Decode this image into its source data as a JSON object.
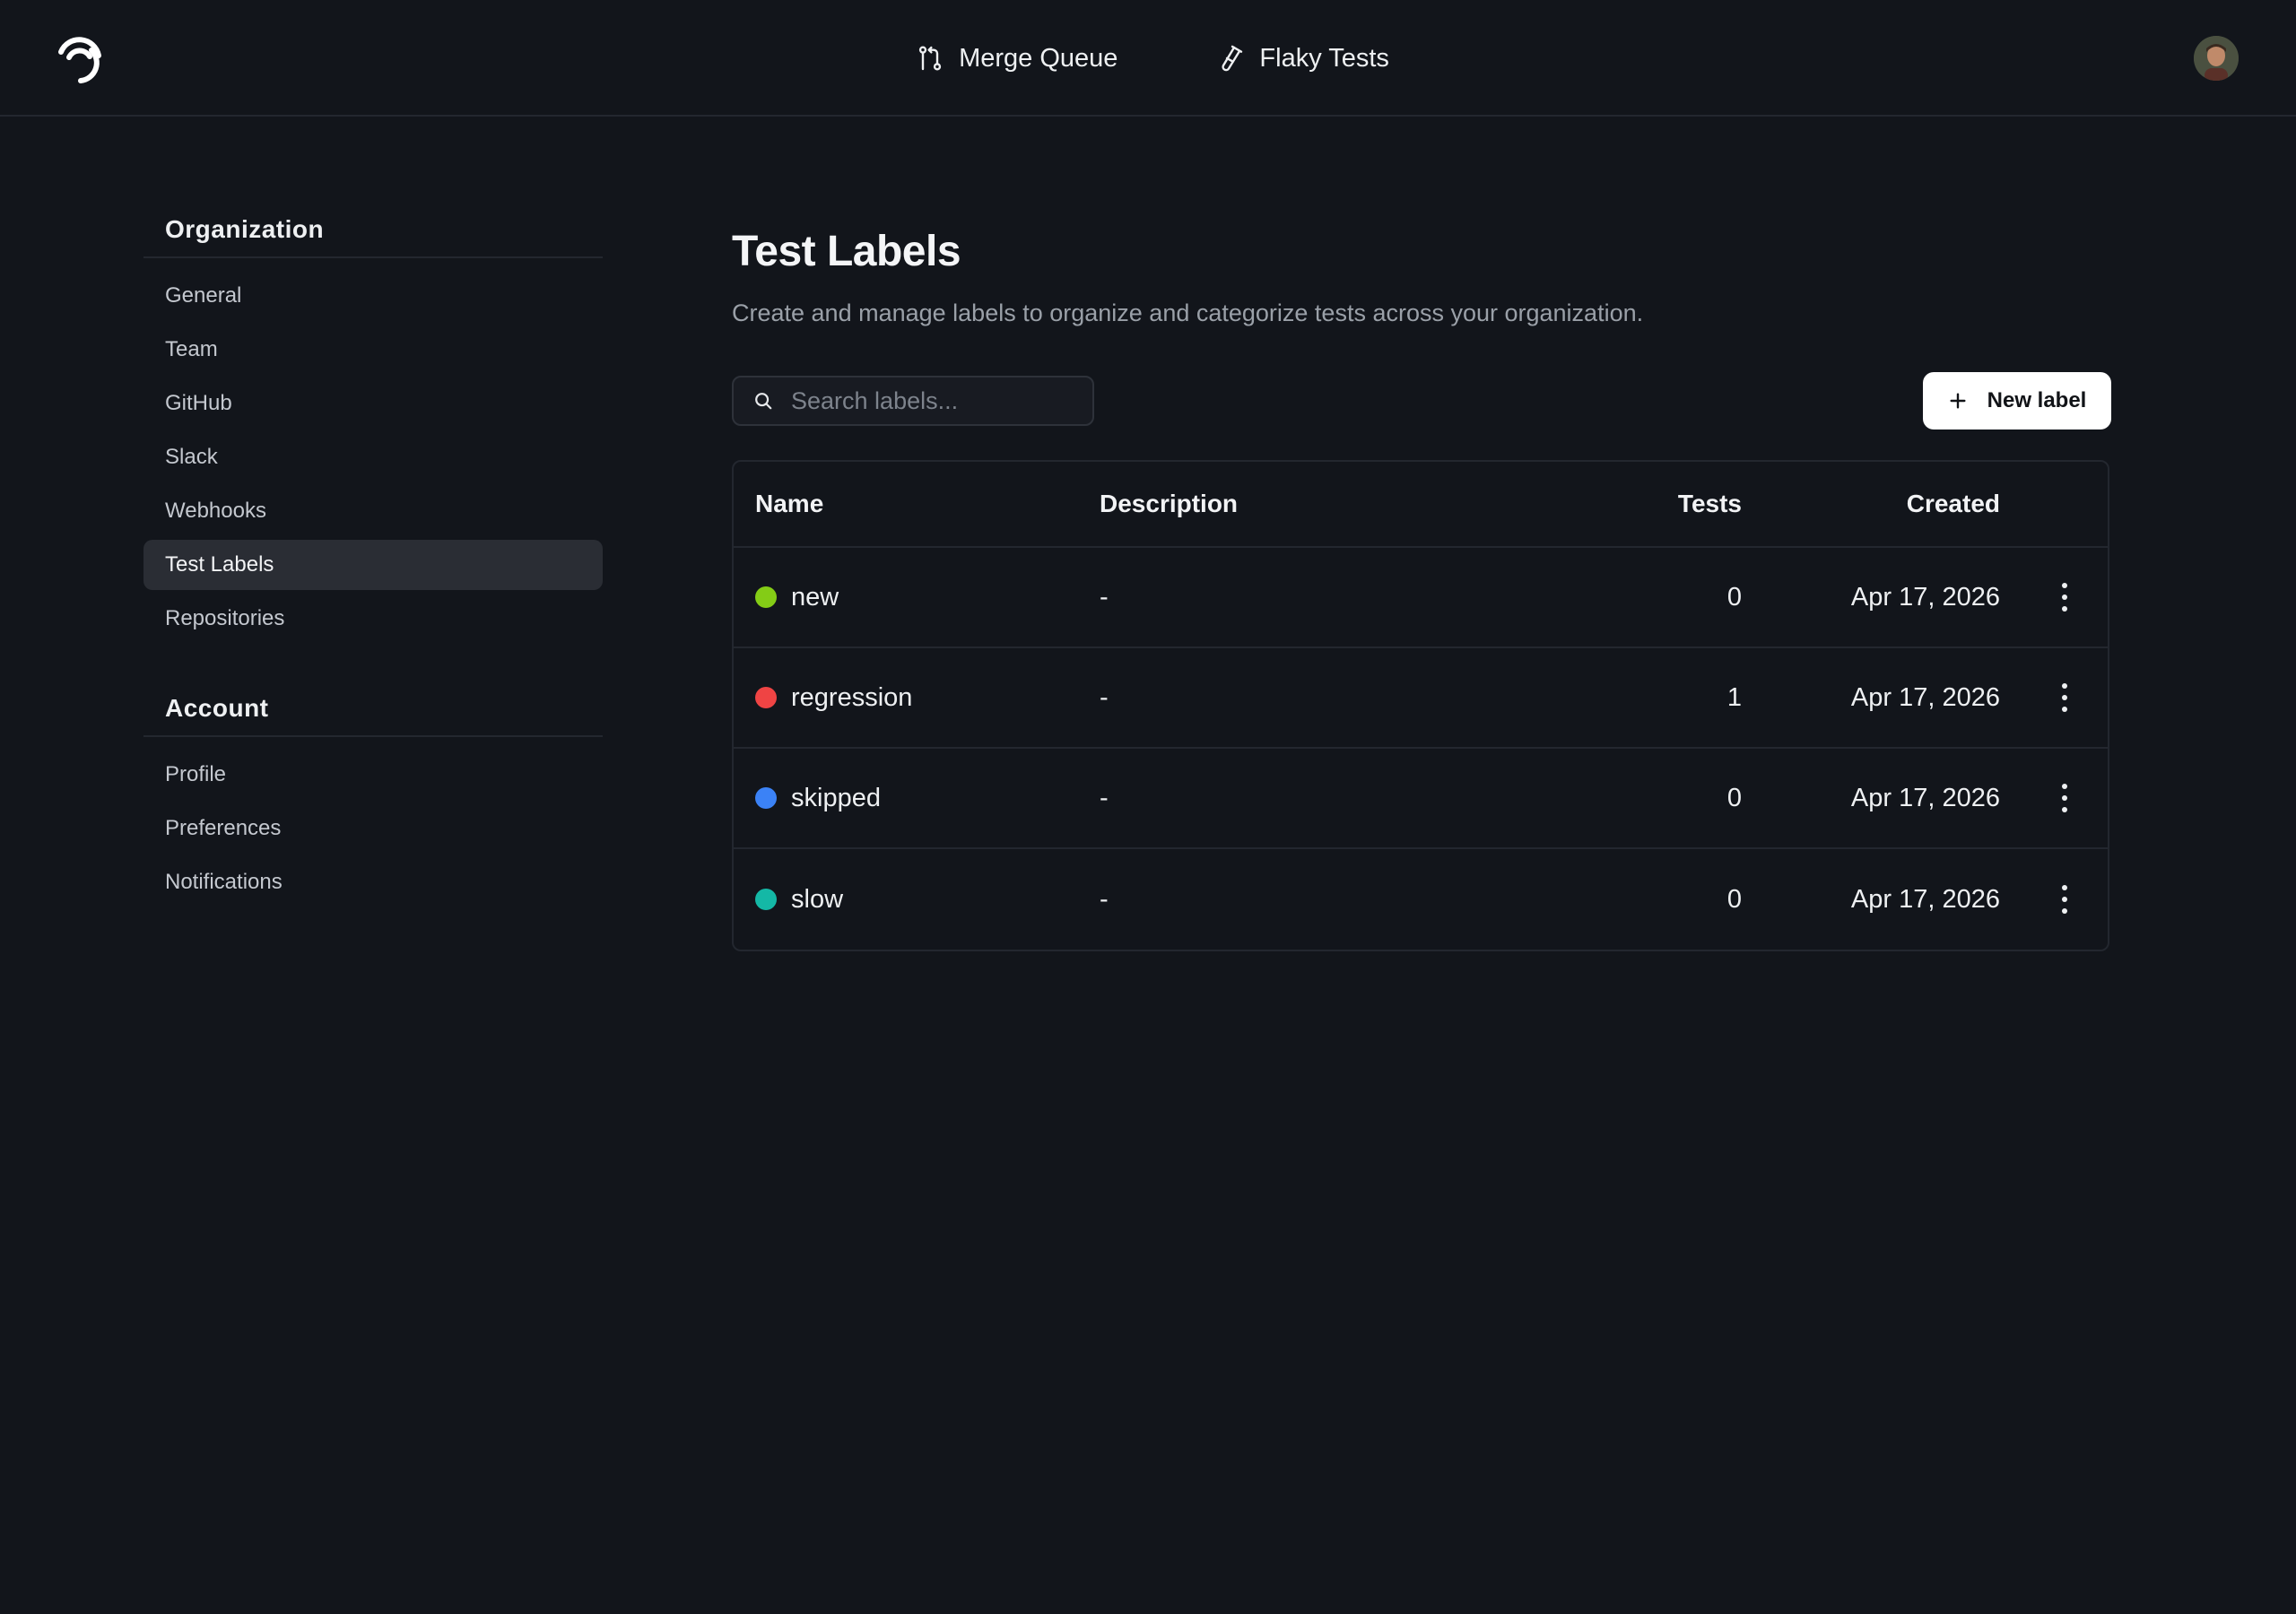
{
  "topnav": {
    "items": [
      {
        "label": "Merge Queue",
        "icon": "git-pull-request-icon"
      },
      {
        "label": "Flaky Tests",
        "icon": "test-tube-icon"
      }
    ]
  },
  "sidebar": {
    "sections": [
      {
        "title": "Organization",
        "items": [
          {
            "label": "General"
          },
          {
            "label": "Team"
          },
          {
            "label": "GitHub"
          },
          {
            "label": "Slack"
          },
          {
            "label": "Webhooks"
          },
          {
            "label": "Test Labels",
            "active": true
          },
          {
            "label": "Repositories"
          }
        ]
      },
      {
        "title": "Account",
        "items": [
          {
            "label": "Profile"
          },
          {
            "label": "Preferences"
          },
          {
            "label": "Notifications"
          }
        ]
      }
    ]
  },
  "main": {
    "title": "Test Labels",
    "subtitle": "Create and manage labels to organize and categorize tests across your organization.",
    "search": {
      "placeholder": "Search labels...",
      "value": ""
    },
    "new_button_label": "New label",
    "table": {
      "columns": {
        "name": "Name",
        "description": "Description",
        "tests": "Tests",
        "created": "Created"
      },
      "rows": [
        {
          "name": "new",
          "color": "#84cc16",
          "description": "-",
          "tests": "0",
          "created": "Apr 17, 2026"
        },
        {
          "name": "regression",
          "color": "#ef4444",
          "description": "-",
          "tests": "1",
          "created": "Apr 17, 2026"
        },
        {
          "name": "skipped",
          "color": "#3b82f6",
          "description": "-",
          "tests": "0",
          "created": "Apr 17, 2026"
        },
        {
          "name": "slow",
          "color": "#14b8a6",
          "description": "-",
          "tests": "0",
          "created": "Apr 17, 2026"
        }
      ]
    }
  }
}
